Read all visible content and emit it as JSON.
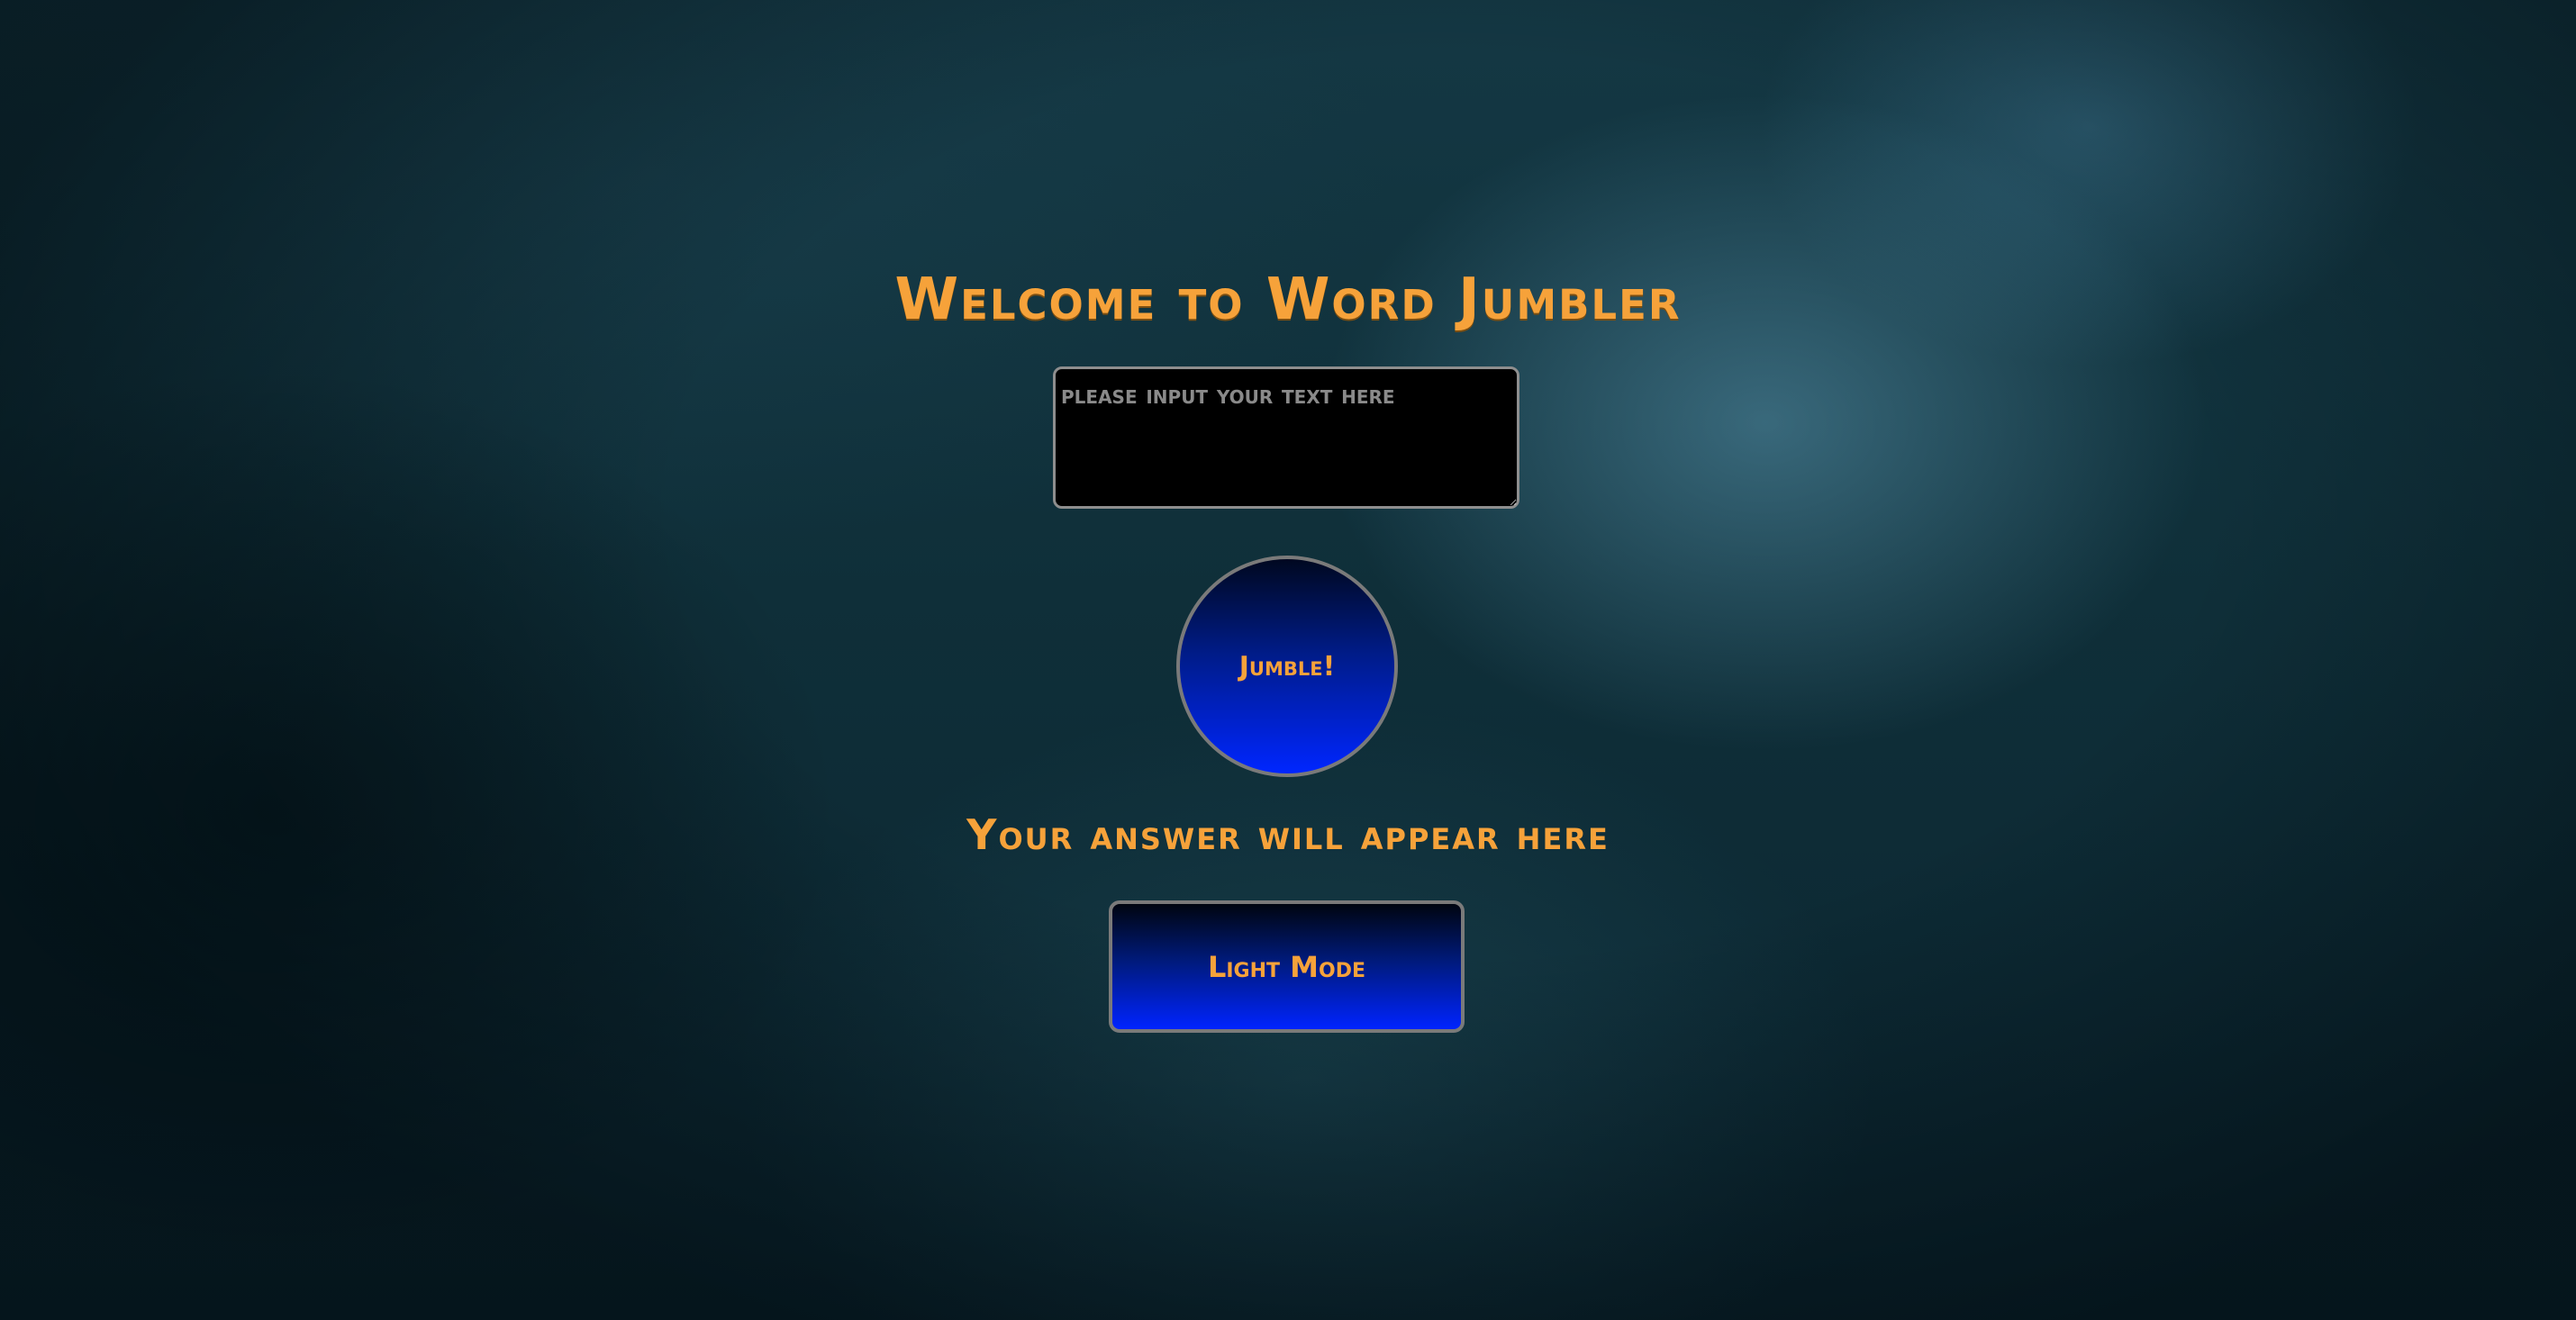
{
  "page": {
    "title": "Welcome to Word Jumbler"
  },
  "input": {
    "placeholder": "please input your text here",
    "value": ""
  },
  "jumble_button": {
    "label": "Jumble!"
  },
  "answer": {
    "text": "Your answer will appear here"
  },
  "mode_button": {
    "label": "Light Mode"
  },
  "colors": {
    "accent_text": "#f6a23a",
    "button_gradient_top": "#000820",
    "button_gradient_bottom": "#0026ff",
    "input_background": "#000000",
    "background": "#0d2a33"
  }
}
